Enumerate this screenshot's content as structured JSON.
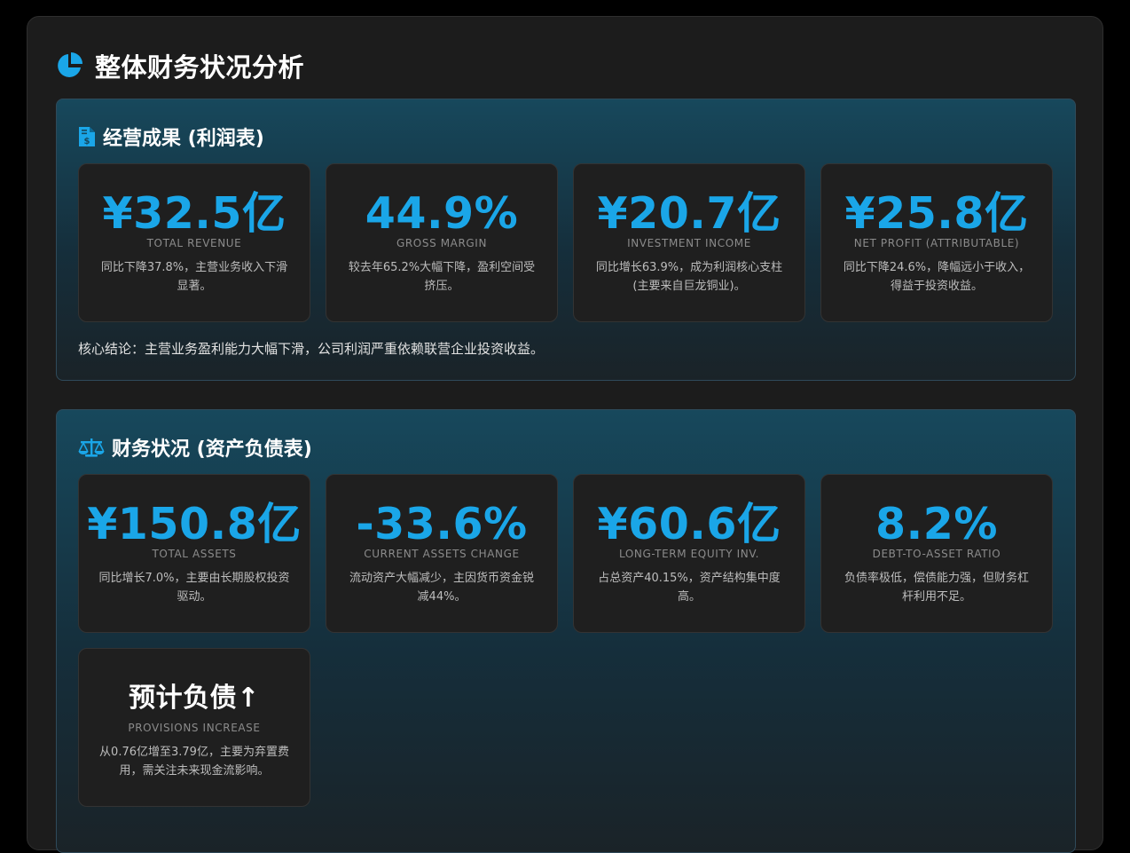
{
  "page": {
    "title": "整体财务状况分析",
    "icon": "pie-chart-icon",
    "accent_color": "#1aa6e8"
  },
  "income_section": {
    "title": "经营成果 (利润表)",
    "icon": "invoice-dollar-icon",
    "cards": [
      {
        "value": "¥32.5亿",
        "caption": "TOTAL REVENUE",
        "desc": "同比下降37.8%，主营业务收入下滑显著。"
      },
      {
        "value": "44.9%",
        "caption": "GROSS MARGIN",
        "desc": "较去年65.2%大幅下降，盈利空间受挤压。"
      },
      {
        "value": "¥20.7亿",
        "caption": "INVESTMENT INCOME",
        "desc": "同比增长63.9%，成为利润核心支柱 (主要来自巨龙铜业)。"
      },
      {
        "value": "¥25.8亿",
        "caption": "NET PROFIT (ATTRIBUTABLE)",
        "desc": "同比下降24.6%，降幅远小于收入，得益于投资收益。"
      }
    ],
    "conclusion": "核心结论：主营业务盈利能力大幅下滑，公司利润严重依赖联营企业投资收益。"
  },
  "balance_section": {
    "title": "财务状况 (资产负债表)",
    "icon": "balance-scale-icon",
    "cards": [
      {
        "value": "¥150.8亿",
        "caption": "TOTAL ASSETS",
        "desc": "同比增长7.0%，主要由长期股权投资驱动。"
      },
      {
        "value": "-33.6%",
        "caption": "CURRENT ASSETS CHANGE",
        "desc": "流动资产大幅减少，主因货币资金锐减44%。"
      },
      {
        "value": "¥60.6亿",
        "caption": "LONG-TERM EQUITY INV.",
        "desc": "占总资产40.15%，资产结构集中度高。"
      },
      {
        "value": "8.2%",
        "caption": "DEBT-TO-ASSET RATIO",
        "desc": "负债率极低，偿债能力强，但财务杠杆利用不足。"
      },
      {
        "value": "预计负债↑",
        "caption": "PROVISIONS INCREASE",
        "desc": "从0.76亿增至3.79亿，主要为弃置费用，需关注未来现金流影响。"
      }
    ]
  }
}
